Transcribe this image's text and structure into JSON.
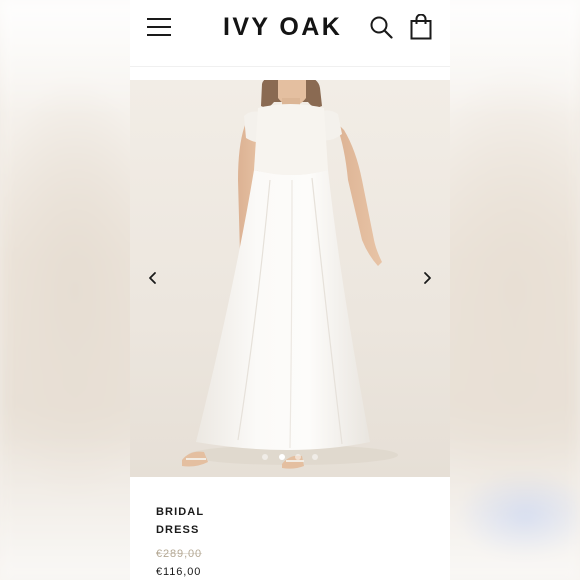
{
  "header": {
    "logo_text": "IVY OAK",
    "menu_icon": "hamburger-menu-icon",
    "search_icon": "search-icon",
    "cart_icon": "shopping-bag-icon"
  },
  "gallery": {
    "prev_icon": "chevron-left-icon",
    "next_icon": "chevron-right-icon",
    "dot_count": 4,
    "active_dot": 1
  },
  "product": {
    "title": "BRIDAL DRESS",
    "price_original": "€289,00",
    "price_sale": "€116,00"
  },
  "colors": {
    "logo": "#141414",
    "price_original": "#b4a894",
    "text": "#1a1a1a",
    "background": "#ffffff"
  }
}
